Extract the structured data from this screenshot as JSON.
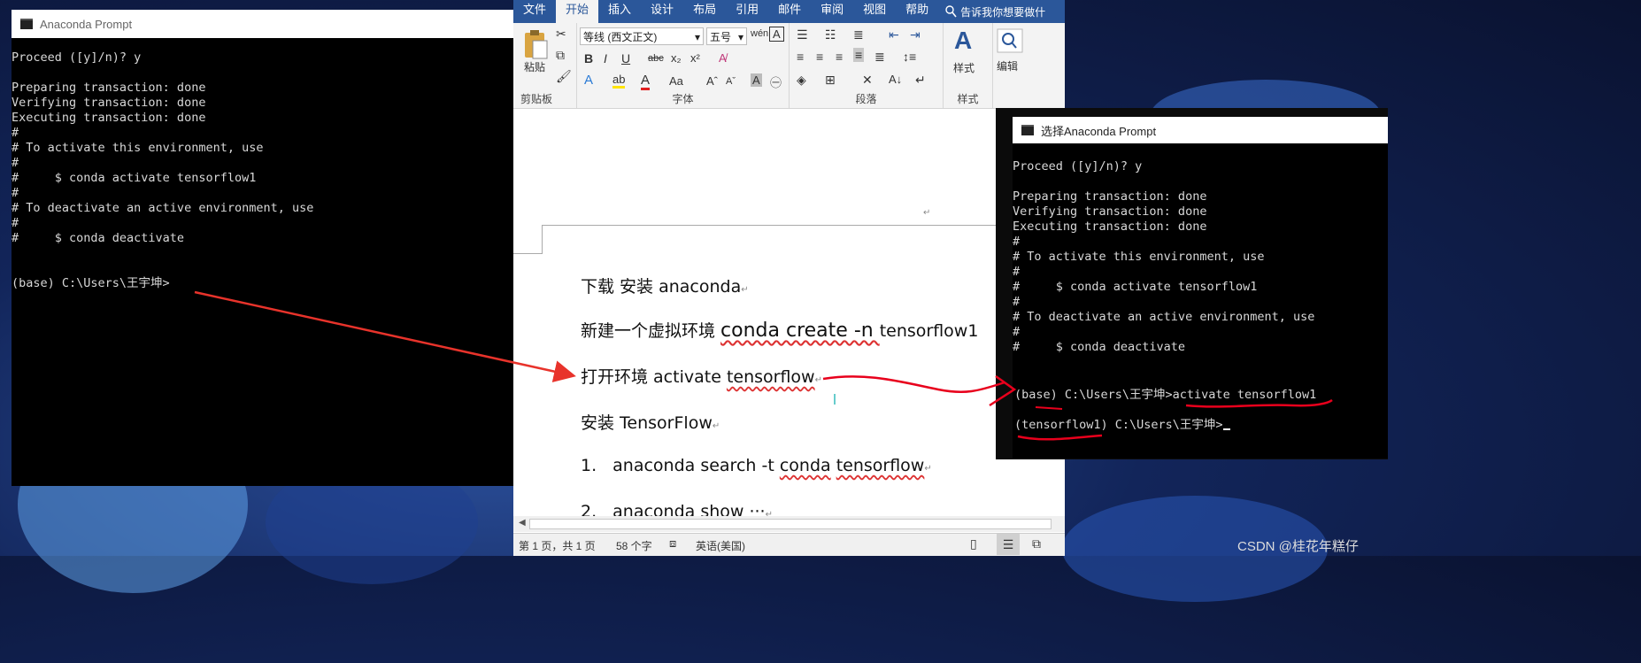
{
  "left_terminal": {
    "title": "Anaconda Prompt",
    "lines": [
      "Proceed ([y]/n)? y",
      "",
      "Preparing transaction: done",
      "Verifying transaction: done",
      "Executing transaction: done",
      "#",
      "# To activate this environment, use",
      "#",
      "#     $ conda activate tensorflow1",
      "#",
      "# To deactivate an active environment, use",
      "#",
      "#     $ conda deactivate",
      "",
      "",
      "(base) C:\\Users\\王宇坤>"
    ]
  },
  "right_terminal": {
    "title": "选择Anaconda Prompt",
    "lines": [
      "Proceed ([y]/n)? y",
      "",
      "Preparing transaction: done",
      "Verifying transaction: done",
      "Executing transaction: done",
      "#",
      "# To activate this environment, use",
      "#",
      "#     $ conda activate tensorflow1",
      "#",
      "# To deactivate an active environment, use",
      "#",
      "#     $ conda deactivate",
      "",
      ""
    ],
    "prompt_line": "(base) C:\\Users\\王宇坤>activate tensorflow1",
    "env_line": "(tensorflow1) C:\\Users\\王宇坤>"
  },
  "word": {
    "tabs": [
      "文件",
      "开始",
      "插入",
      "设计",
      "布局",
      "引用",
      "邮件",
      "审阅",
      "视图",
      "帮助"
    ],
    "active_tab": "开始",
    "tell_me": "告诉我你想要做什",
    "font_name": "等线 (西文正文)",
    "font_size": "五号",
    "groups": {
      "clipboard": "剪贴板",
      "font": "字体",
      "paragraph": "段落",
      "styles": "样式"
    },
    "paste_label": "粘贴",
    "styles_btn": "样式",
    "edit_btn": "编辑",
    "doc_lines": {
      "l1": "下载  安装 anaconda",
      "l2a": "新建一个虚拟环境 ",
      "l2b": "conda create -n ",
      "l2c": "tensorflow1",
      "l3a": "打开环境 activate ",
      "l3b": "tensorflow",
      "l4": "安装 TensorFlow",
      "l5num": "1.",
      "l5a": "anaconda search -t ",
      "l5b": "conda",
      "l5c": " ",
      "l5d": "tensorflow",
      "l6num": "2.",
      "l6": "anaconda show ···"
    },
    "status": {
      "page": "第 1 页，共 1 页",
      "words": "58 个字",
      "language": "英语(美国)"
    }
  },
  "watermark": "CSDN @桂花年糕仔",
  "colors": {
    "word_blue": "#2b579a",
    "arrow_red": "#e8332b",
    "scribble_red": "#e8001c"
  }
}
